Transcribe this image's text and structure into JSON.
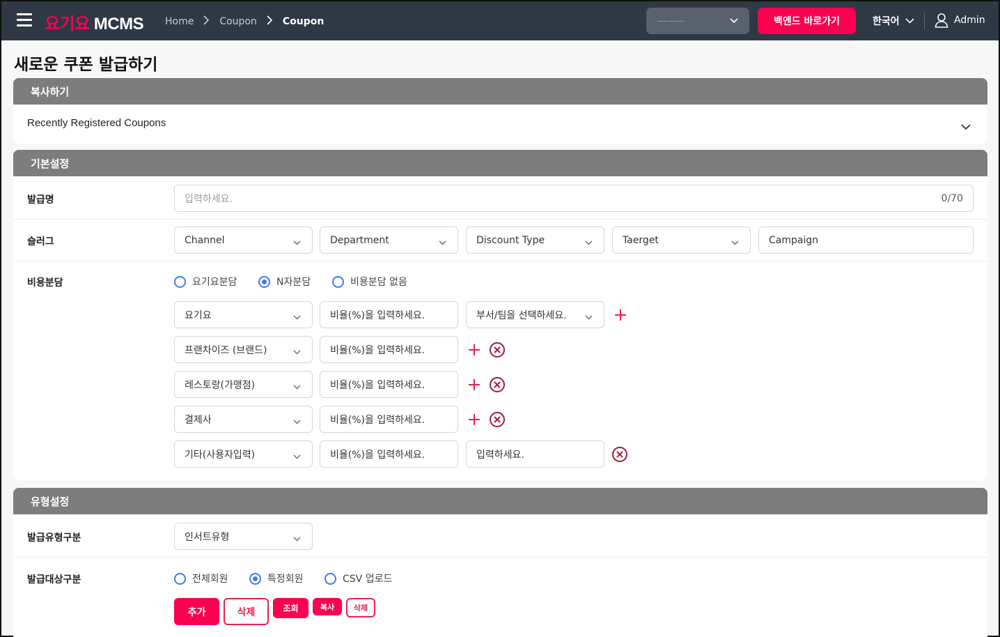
{
  "topbar": {
    "brand": "요기요",
    "system": "MCMS",
    "breadcrumb": [
      "Home",
      "Coupon",
      "Coupon"
    ],
    "select_value": "---------",
    "backend_button": "백엔드 바로가기",
    "language": "한국어",
    "user": "Admin"
  },
  "page_title": "새로운 쿠폰 발급하기",
  "copy_section": {
    "header": "복사하기",
    "accordion_label": "Recently Registered Coupons"
  },
  "basic_section": {
    "header": "기본설정",
    "issue_name": {
      "label": "발급명",
      "placeholder": "입력하세요.",
      "counter": "0/70"
    },
    "slug": {
      "label": "슬러그",
      "fields": [
        "Channel",
        "Department",
        "Discount Type",
        "Taerget",
        "Campaign"
      ]
    },
    "cost_share": {
      "label": "비용분담",
      "options": [
        "요기요분담",
        "N자분담",
        "비용분담 없음"
      ],
      "selected_option": "N자분담",
      "rate_placeholder": "비율(%)을 입력하세요.",
      "rows": [
        {
          "party": "요기요",
          "extra": "부서/팀을 선택하세요."
        },
        {
          "party": "프랜차이즈 (브랜드)"
        },
        {
          "party": "레스토랑(가맹점)"
        },
        {
          "party": "결제사"
        },
        {
          "party": "기타(사용자입력)",
          "extra": "입력하세요."
        }
      ]
    }
  },
  "type_section": {
    "header": "유형설정",
    "issue_type": {
      "label": "발급유형구분",
      "value": "인서트유형"
    },
    "target_type": {
      "label": "발급대상구분",
      "options": [
        "전체회원",
        "특정회원",
        "CSV 업로드"
      ],
      "selected_option": "특정회원"
    },
    "buttons": {
      "add": "추가",
      "delete": "삭제",
      "lookup": "조회",
      "copy": "복사",
      "delete_small": "삭제"
    }
  },
  "colors": {
    "brand": "#fa0050",
    "topbar": "#2f3845",
    "section_header": "#7d7d7d",
    "radio": "#3d7bf0"
  },
  "icons": [
    "menu-icon",
    "chevron-right-icon",
    "chevron-down-icon",
    "user-icon",
    "plus-icon",
    "remove-circle-icon"
  ]
}
